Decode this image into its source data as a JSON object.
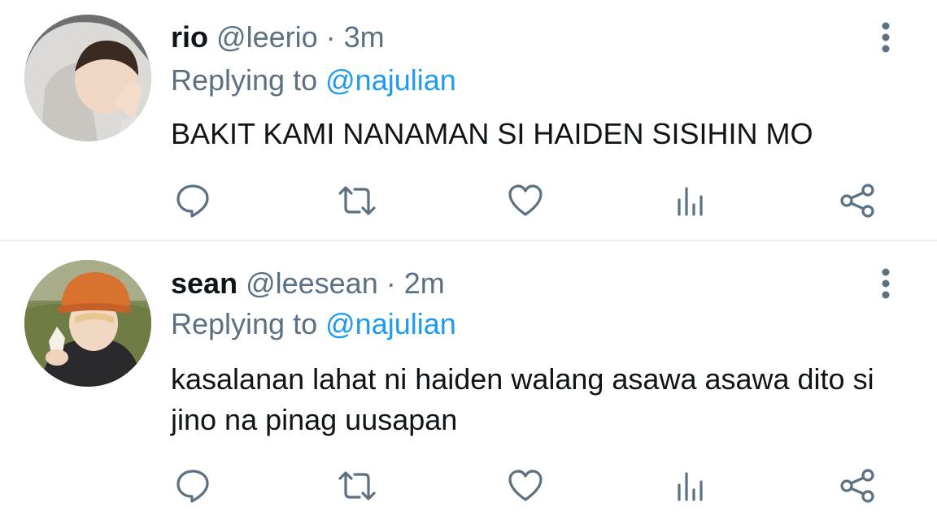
{
  "tweets": [
    {
      "name": "rio",
      "handle": "@leerio",
      "separator": "·",
      "time": "3m",
      "replying_prefix": "Replying to",
      "replying_to": "@najulian",
      "text": "BAKIT KAMI NANAMAN SI HAIDEN SISIHIN MO"
    },
    {
      "name": "sean",
      "handle": "@leesean",
      "separator": "·",
      "time": "2m",
      "replying_prefix": "Replying to",
      "replying_to": "@najulian",
      "text": "kasalanan lahat ni haiden walang asawa asawa dito si jino na pinag uusapan"
    }
  ],
  "icons": {
    "more": "vertical-dots-icon",
    "reply": "comment-icon",
    "retweet": "retweet-icon",
    "like": "heart-icon",
    "analytics": "bar-chart-icon",
    "share": "share-icon"
  },
  "colors": {
    "text": "#0f1419",
    "secondary": "#5b7083",
    "link": "#1d9bf0",
    "divider": "#e6ecf0"
  }
}
